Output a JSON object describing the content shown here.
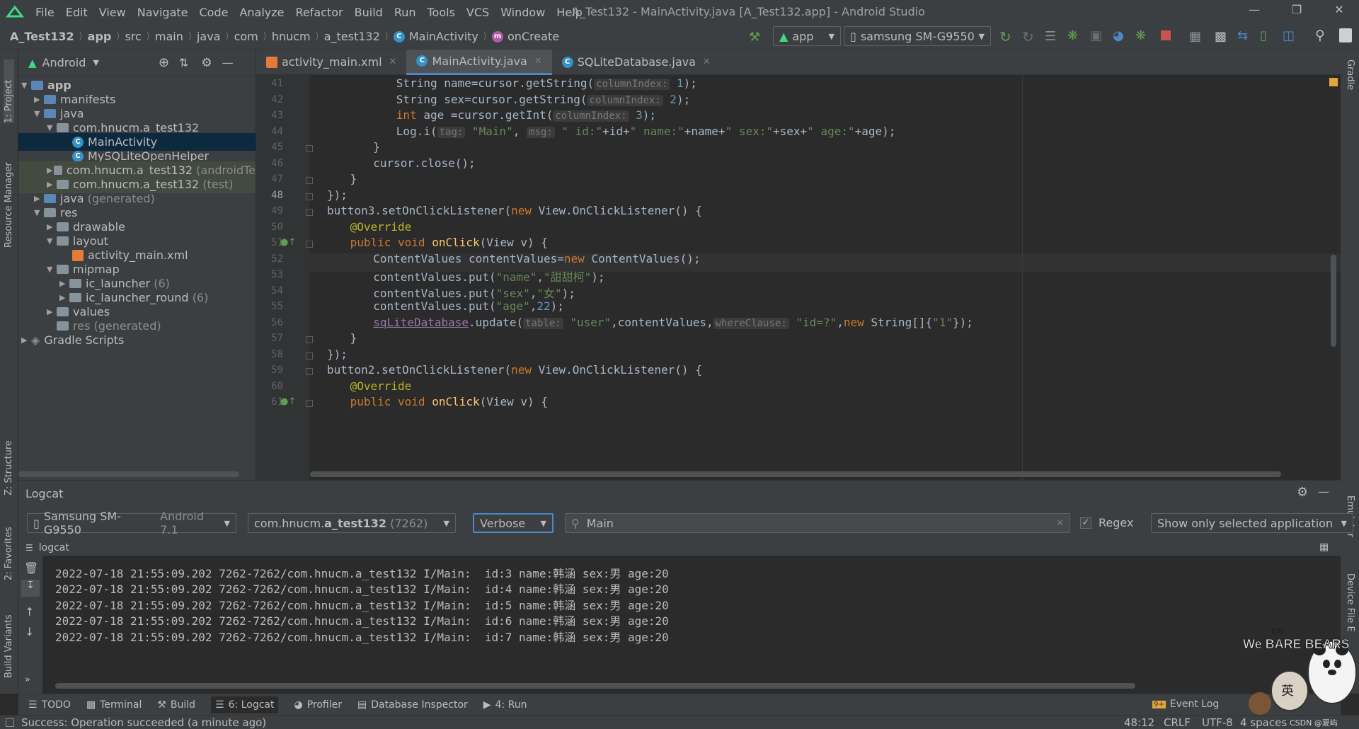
{
  "menu": [
    "File",
    "Edit",
    "View",
    "Navigate",
    "Code",
    "Analyze",
    "Refactor",
    "Build",
    "Run",
    "Tools",
    "VCS",
    "Window",
    "Help"
  ],
  "window_title": "A_Test132 - MainActivity.java [A_Test132.app] - Android Studio",
  "breadcrumbs": [
    "A_Test132",
    "app",
    "src",
    "main",
    "java",
    "com",
    "hnucm",
    "a_test132",
    "MainActivity",
    "onCreate"
  ],
  "toolbar": {
    "run_config": "app",
    "device": "samsung SM-G9550"
  },
  "project_panel": {
    "view_mode": "Android",
    "tree": [
      {
        "label": "app",
        "suffix": ""
      },
      {
        "label": "manifests",
        "suffix": ""
      },
      {
        "label": "java",
        "suffix": ""
      },
      {
        "label": "com.hnucm.a_test132",
        "suffix": ""
      },
      {
        "label": "MainActivity",
        "suffix": ""
      },
      {
        "label": "MySQLiteOpenHelper",
        "suffix": ""
      },
      {
        "label": "com.hnucm.a_test132",
        "suffix": "(androidTe"
      },
      {
        "label": "com.hnucm.a_test132",
        "suffix": "(test)"
      },
      {
        "label": "java",
        "suffix": "(generated)"
      },
      {
        "label": "res",
        "suffix": ""
      },
      {
        "label": "drawable",
        "suffix": ""
      },
      {
        "label": "layout",
        "suffix": ""
      },
      {
        "label": "activity_main.xml",
        "suffix": ""
      },
      {
        "label": "mipmap",
        "suffix": ""
      },
      {
        "label": "ic_launcher",
        "suffix": "(6)"
      },
      {
        "label": "ic_launcher_round",
        "suffix": "(6)"
      },
      {
        "label": "values",
        "suffix": ""
      },
      {
        "label": "res",
        "suffix": "(generated)"
      },
      {
        "label": "Gradle Scripts",
        "suffix": ""
      }
    ]
  },
  "side_tabs_left": [
    "1: Project",
    "Resource Manager",
    "Z: Structure",
    "2: Favorites",
    "Build Variants"
  ],
  "side_tabs_right": [
    "Gradle",
    "Emulator",
    "Device File E"
  ],
  "editor_tabs": [
    "activity_main.xml",
    "MainActivity.java",
    "SQLiteDatabase.java"
  ],
  "code": {
    "line_numbers": [
      "41",
      "42",
      "43",
      "44",
      "45",
      "46",
      "47",
      "48",
      "49",
      "50",
      "51",
      "52",
      "53",
      "54",
      "55",
      "56",
      "57",
      "58",
      "59",
      "60",
      "61"
    ],
    "l41": {
      "a": "String name=cursor.getString(",
      "hint": "columnIndex:",
      "b": "1",
      ");": ");"
    },
    "l42": {
      "a": "String sex=cursor.getString(",
      "hint": "columnIndex:",
      "b": "2"
    },
    "l43": {
      "kw": "int",
      "a": " age =cursor.getInt(",
      "hint": "columnIndex:",
      "b": "3"
    },
    "l44": {
      "a": "Log.i(",
      "h1": "tag:",
      "s1": "\"Main\"",
      "h2": "msg:",
      "s2": "\" id:\"",
      "p1": "+id+",
      "s3": "\" name:\"",
      "p2": "+name+",
      "s4": "\" sex:\"",
      "p3": "+sex+",
      "s5": "\" age:\"",
      "p4": "+age);"
    },
    "l45": "}",
    "l46": "cursor.close();",
    "l47": "}",
    "l48": "});",
    "l49": {
      "a": "button3.setOnClickListener(",
      "kw": "new",
      "b": " View.OnClickListener() {"
    },
    "l50": "@Override",
    "l51": {
      "kw": "public void ",
      "fn": "onClick",
      "b": "(View v) {"
    },
    "l52": {
      "a": "ContentValues contentValues=",
      "kw": "new",
      "b": " ContentValues();"
    },
    "l53": {
      "a": "contentValues.put(",
      "s1": "\"name\"",
      "c": ",",
      "s2": "\"甜甜柯\"",
      "e": ");"
    },
    "l54": {
      "a": "contentValues.put(",
      "s1": "\"sex\"",
      "c": ",",
      "s2": "\"女\"",
      "e": ");"
    },
    "l55": {
      "a": "contentValues.put(",
      "s1": "\"age\"",
      "c": ",",
      "n": "22",
      "e": ");"
    },
    "l56": {
      "f": "sqLiteDatabase",
      "a": ".update(",
      "h1": "table:",
      "s1": "\"user\"",
      "b": ",contentValues,",
      "h2": "whereClause:",
      "s2": "\"id=?\"",
      "c": ",",
      "kw": "new",
      "d": " String[]{",
      "s3": "\"1\"",
      "e": "});"
    },
    "l57": "}",
    "l58": "});",
    "l59": {
      "a": "button2.setOnClickListener(",
      "kw": "new",
      "b": " View.OnClickListener() {"
    },
    "l60": "@Override",
    "l61": {
      "kw": "public void ",
      "fn": "onClick",
      "b": "(View v) {"
    }
  },
  "logcat": {
    "title": "Logcat",
    "device": "Samsung SM-G9550",
    "device_suffix": "Android 7.1",
    "process_prefix": "com.hnucm.",
    "process_bold": "a_test132",
    "process_pid": "(7262)",
    "level": "Verbose",
    "search": "Main",
    "regex_label": "Regex",
    "filter": "Show only selected application",
    "sub_tab": "logcat",
    "lines": [
      "2022-07-18 21:55:09.202 7262-7262/com.hnucm.a_test132 I/Main:  id:3 name:韩涵 sex:男 age:20",
      "2022-07-18 21:55:09.202 7262-7262/com.hnucm.a_test132 I/Main:  id:4 name:韩涵 sex:男 age:20",
      "2022-07-18 21:55:09.202 7262-7262/com.hnucm.a_test132 I/Main:  id:5 name:韩涵 sex:男 age:20",
      "2022-07-18 21:55:09.202 7262-7262/com.hnucm.a_test132 I/Main:  id:6 name:韩涵 sex:男 age:20",
      "2022-07-18 21:55:09.202 7262-7262/com.hnucm.a_test132 I/Main:  id:7 name:韩涵 sex:男 age:20"
    ]
  },
  "bottom_tabs": [
    "TODO",
    "Terminal",
    "Build",
    "6: Logcat",
    "Profiler",
    "Database Inspector",
    "4: Run"
  ],
  "event_log": "Event Log",
  "event_log_badge": "9+",
  "status": {
    "message": "Success: Operation succeeded (a minute ago)",
    "position": "48:12",
    "line_sep": "CRLF",
    "encoding": "UTF-8",
    "indent": "4 spaces",
    "watermark": "CSDN @夏屿"
  },
  "mascot": {
    "brand": "We BARE BEARS",
    "ime": "英",
    "cn": "CN"
  },
  "colors": {
    "accent": "#4a88c7",
    "keyword": "#cc7832",
    "string": "#6a8759",
    "number": "#6897bb"
  }
}
